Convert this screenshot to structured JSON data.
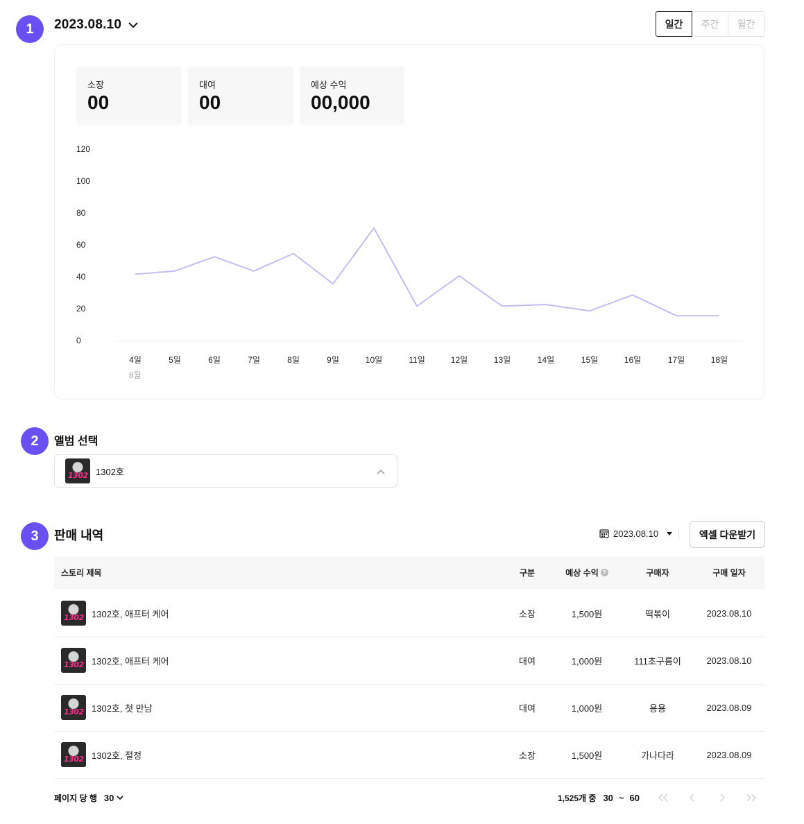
{
  "steps": {
    "one": "1",
    "two": "2",
    "three": "3"
  },
  "header": {
    "date": "2023.08.10"
  },
  "period": {
    "daily": "일간",
    "weekly": "주간",
    "monthly": "월간"
  },
  "stats": [
    {
      "label": "소장",
      "value": "00"
    },
    {
      "label": "대여",
      "value": "00"
    },
    {
      "label": "예상 수익",
      "value": "00,000"
    }
  ],
  "chart_data": {
    "type": "line",
    "categories": [
      "4일",
      "5일",
      "6일",
      "7일",
      "8일",
      "9일",
      "10일",
      "11일",
      "12일",
      "13일",
      "14일",
      "15일",
      "16일",
      "17일",
      "18일"
    ],
    "values": [
      42,
      44,
      53,
      44,
      55,
      36,
      71,
      22,
      41,
      22,
      23,
      19,
      29,
      16,
      16
    ],
    "yticks": [
      "120",
      "100",
      "80",
      "60",
      "40",
      "20",
      "0"
    ],
    "ylim": [
      0,
      120
    ],
    "month_label": "8월",
    "line_color": "#c5bdf2",
    "grid": false
  },
  "album": {
    "title": "앨범 선택",
    "selected": "1302호"
  },
  "sales": {
    "title": "판매 내역",
    "date_filter": "2023.08.10",
    "excel_button": "엑셀 다운받기",
    "columns": {
      "story": "스토리 제목",
      "type": "구분",
      "revenue": "예상 수익",
      "buyer": "구매자",
      "date": "구매 일자"
    },
    "rows": [
      {
        "story": "1302호, 애프터 케어",
        "type": "소장",
        "revenue": "1,500원",
        "buyer": "떡볶이",
        "date": "2023.08.10"
      },
      {
        "story": "1302호, 애프터 케어",
        "type": "대여",
        "revenue": "1,000원",
        "buyer": "111초구름이",
        "date": "2023.08.10"
      },
      {
        "story": "1302호, 첫 만남",
        "type": "대여",
        "revenue": "1,000원",
        "buyer": "용용",
        "date": "2023.08.09"
      },
      {
        "story": "1302호, 절정",
        "type": "소장",
        "revenue": "1,500원",
        "buyer": "가나다라",
        "date": "2023.08.09"
      }
    ]
  },
  "pagination": {
    "rows_per_page_label": "페이지 당 행",
    "rows_per_page": "30",
    "total": "1,525개 중",
    "range_start": "30",
    "range_sep": "~",
    "range_end": "60"
  },
  "colors": {
    "accent": "#6a4ff2",
    "line": "#c5bdf2"
  }
}
